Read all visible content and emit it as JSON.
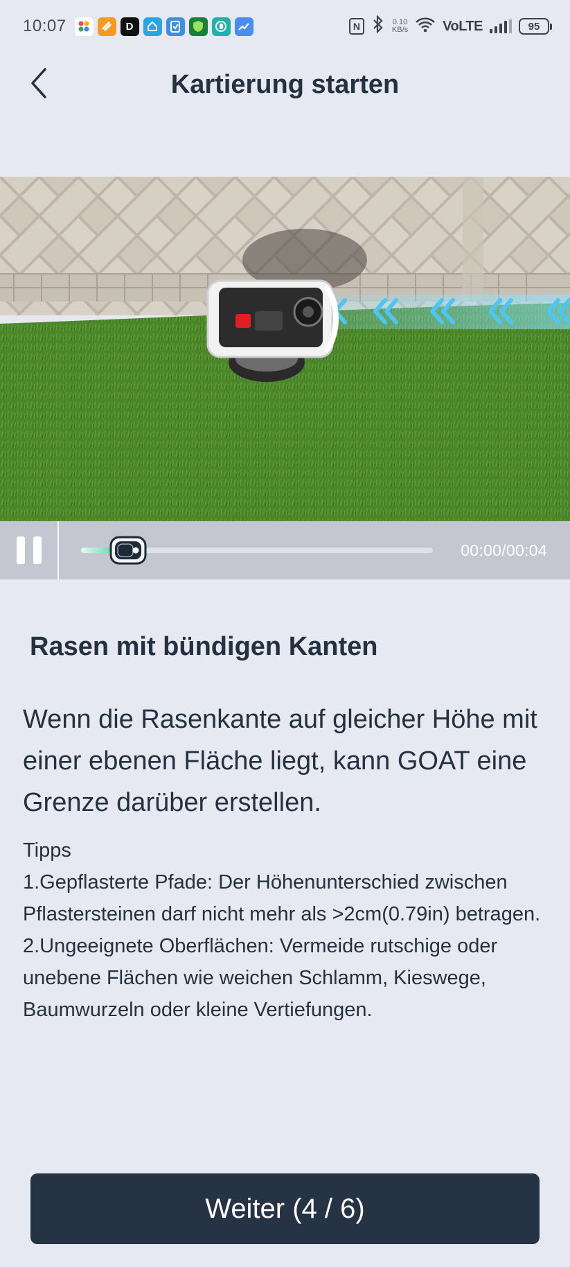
{
  "status_bar": {
    "time": "10:07",
    "network_speed_value": "0.10",
    "network_speed_unit": "KB/s",
    "network_type": "VoLTE",
    "battery": "95",
    "nfc_label": "N"
  },
  "header": {
    "title": "Kartierung starten"
  },
  "video": {
    "time": "00:00/00:04",
    "progress_fraction": 0.1
  },
  "content": {
    "section_title": "Rasen mit bündigen Kanten",
    "description": "Wenn die Rasenkante auf gleicher Höhe mit einer ebenen Fläche liegt, kann GOAT eine Grenze darüber erstellen.",
    "tips_heading": "Tipps",
    "tip_1": "1.Gepflasterte Pfade: Der Höhenunterschied zwischen Pflastersteinen darf nicht mehr als >2cm(0.79in) betragen.",
    "tip_2": "2.Ungeeignete Oberflächen: Vermeide rutschige oder unebene Flächen wie weichen Schlamm, Kieswege, Baumwurzeln oder kleine Vertiefungen."
  },
  "footer": {
    "next_label": "Weiter (4 / 6)"
  },
  "colors": {
    "background": "#e6e9f1",
    "primary_button": "#253345",
    "accent": "#3fcf9c",
    "text": "#243141"
  }
}
